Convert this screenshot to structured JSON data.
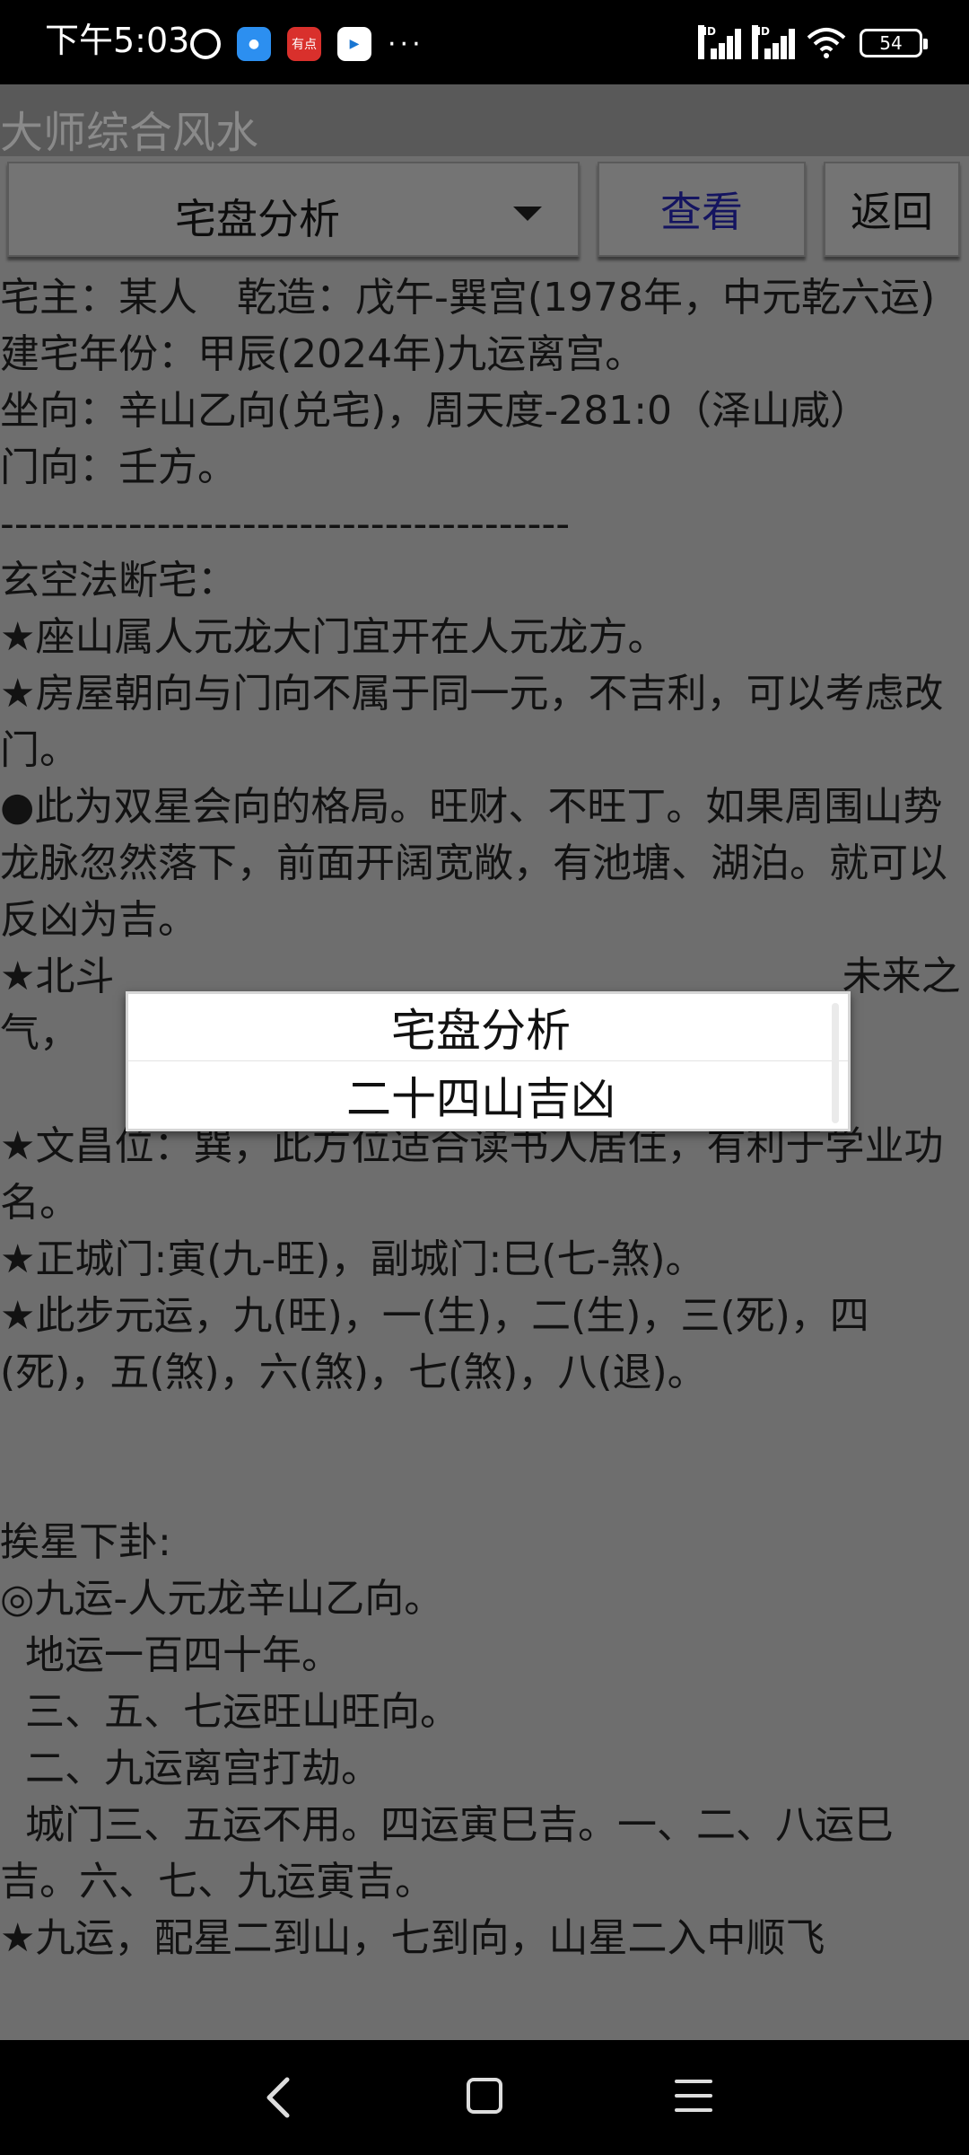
{
  "status_bar": {
    "time": "下午5:03",
    "app_badge_text": "有点",
    "battery": "54",
    "hd_label": "HD",
    "more": "···"
  },
  "app": {
    "title": "大师综合风水"
  },
  "toolbar": {
    "spinner_selected": "宅盘分析",
    "view_label": "查看",
    "back_label": "返回"
  },
  "content": {
    "lines": [
      "宅主：某人　乾造：戊午-巽宫(1978年，中元乾六运)",
      "建宅年份：甲辰(2024年)九运离宫。",
      "坐向：辛山乙向(兑宅)，周天度-281:0（泽山咸）",
      "门向：壬方。",
      "----------------------------------------",
      "玄空法断宅：",
      "★座山属人元龙大门宜开在人元龙方。",
      "★房屋朝向与门向不属于同一元，不吉利，可以考虑改门。",
      "●此为双星会向的格局。旺财、不旺丁。如果周围山势龙脉忽然落下，前面开阔宽敞，有池塘、湖泊。就可以反凶为吉。",
      "★北斗                                                          未来之气，",
      "",
      "★文昌位：巽，此方位适合读书人居住，有利于学业功名。",
      "★正城门:寅(九-旺)，副城门:巳(七-煞)。",
      "★此步元运，九(旺)，一(生)，二(生)，三(死)，四(死)，五(煞)，六(煞)，七(煞)，八(退)。",
      "",
      "",
      "挨星下卦:",
      "◎九运-人元龙辛山乙向。",
      "  地运一百四十年。",
      "  三、五、七运旺山旺向。",
      "  二、九运离宫打劫。",
      "  城门三、五运不用。四运寅巳吉。一、二、八运巳吉。六、七、九运寅吉。",
      "★九运，配星二到山，七到向，山星二入中顺飞"
    ]
  },
  "popup": {
    "options": [
      "宅盘分析",
      "二十四山吉凶"
    ]
  }
}
